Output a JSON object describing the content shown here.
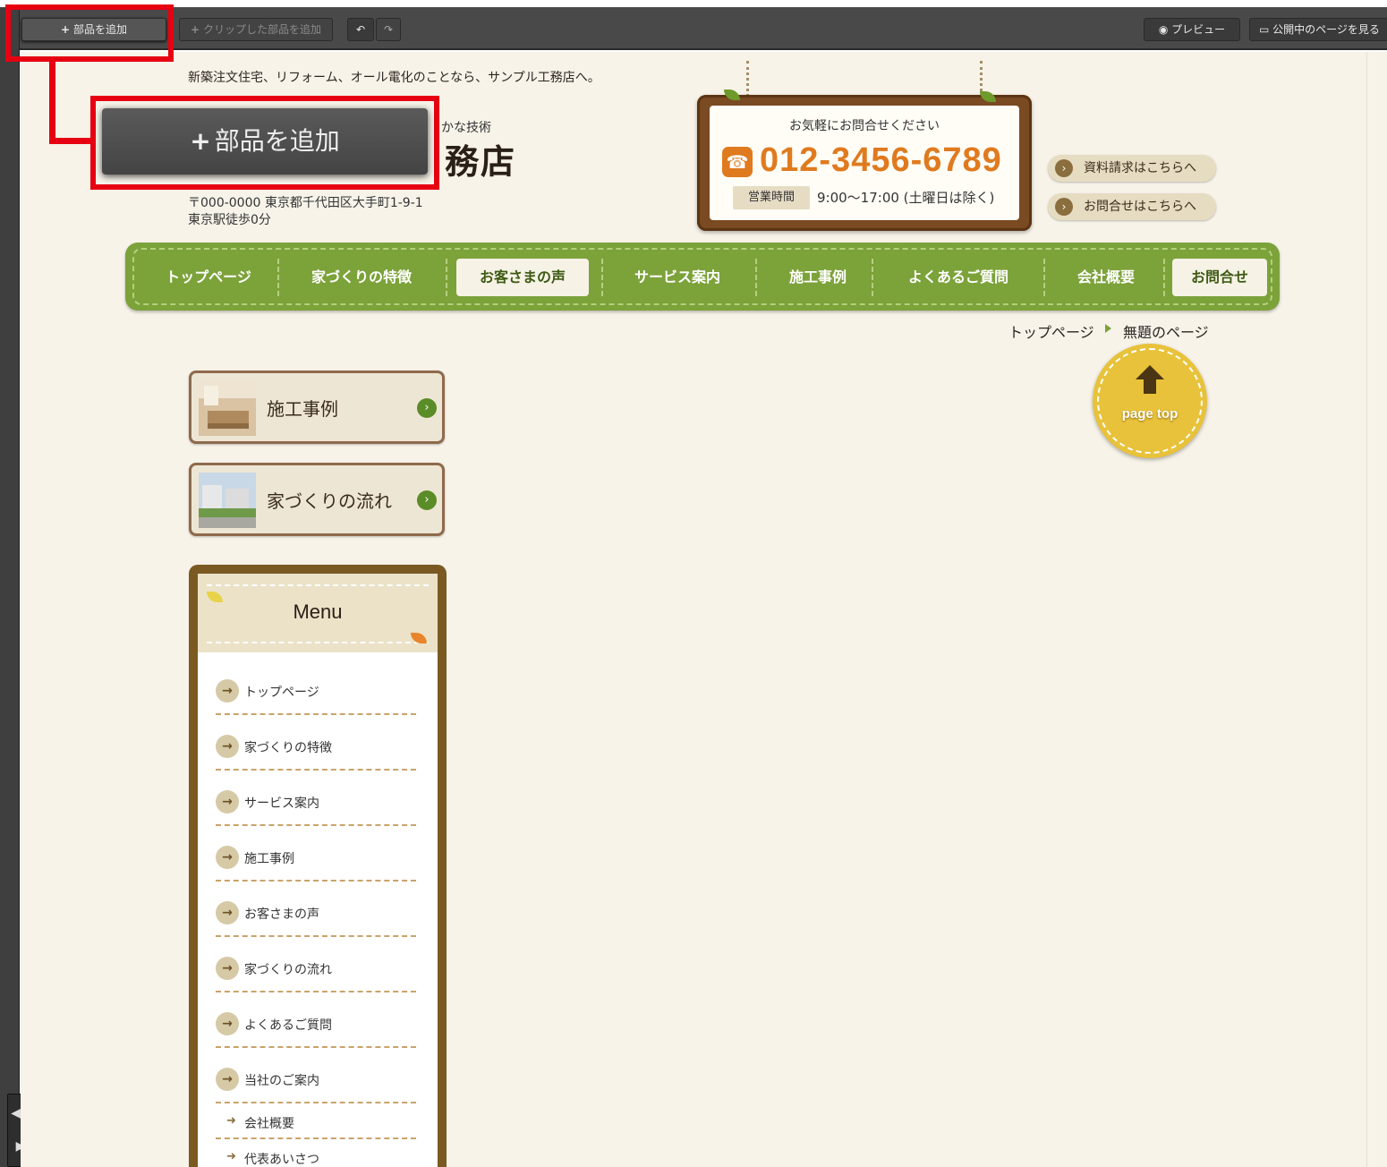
{
  "toolbar": {
    "add_part": "部品を追加",
    "add_clipped": "クリップした部品を追加",
    "undo": "↶",
    "redo": "↷",
    "preview": "プレビュー",
    "view_public": "公開中のページを見る"
  },
  "annotation": {
    "zoom_label": "部品を追加"
  },
  "header": {
    "tagline": "新築注文住宅、リフォーム、オール電化のことなら、サンプル工務店へ。",
    "logo_sub": "かな技術",
    "logo_main": "務店",
    "address_line1": "〒000-0000 東京都千代田区大手町1-9-1",
    "address_line2": "東京駅徒歩0分"
  },
  "contact": {
    "heading": "お気軽にお問合せください",
    "phone": "012-3456-6789",
    "hours_label": "営業時間",
    "hours": "9:00〜17:00 (土曜日は除く)",
    "links": [
      "資料請求はこちらへ",
      "お問合せはこちらへ"
    ]
  },
  "nav": {
    "items": [
      {
        "label": "トップページ",
        "active": false
      },
      {
        "label": "家づくりの特徴",
        "active": false
      },
      {
        "label": "お客さまの声",
        "active": true
      },
      {
        "label": "サービス案内",
        "active": false
      },
      {
        "label": "施工事例",
        "active": false
      },
      {
        "label": "よくあるご質問",
        "active": false
      },
      {
        "label": "会社概要",
        "active": false
      },
      {
        "label": "お問合せ",
        "active": true
      }
    ]
  },
  "breadcrumb": {
    "home": "トップページ",
    "current": "無題のページ"
  },
  "page_top": "page top",
  "banners": [
    {
      "label": "施工事例"
    },
    {
      "label": "家づくりの流れ"
    }
  ],
  "side_menu": {
    "title": "Menu",
    "items": [
      "トップページ",
      "家づくりの特徴",
      "サービス案内",
      "施工事例",
      "お客さまの声",
      "家づくりの流れ",
      "よくあるご質問",
      "当社のご案内"
    ],
    "sub_items": [
      "会社概要",
      "代表あいさつ"
    ]
  },
  "colors": {
    "accent_orange": "#e07a1f",
    "nav_green": "#7ca23a",
    "annotation_red": "#e60012",
    "toolbar_gray": "#494949"
  }
}
